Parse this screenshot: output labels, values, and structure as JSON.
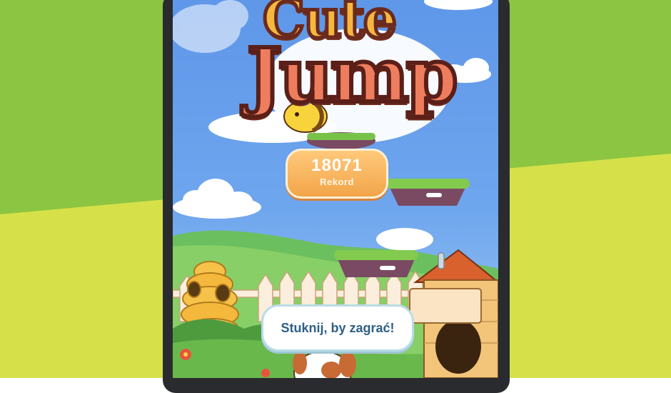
{
  "game": {
    "title_line1": "Cute",
    "title_line2": "Jump",
    "score": {
      "value": "18071",
      "label": "Rekord"
    },
    "start_prompt": "Stuknij, by zagrać!"
  },
  "colors": {
    "background_top": "#8bc34a",
    "background_bottom": "#d7e24c",
    "sky": "#6ea6ee",
    "score_badge": "#f5b056",
    "button_text": "#2e5f86"
  }
}
